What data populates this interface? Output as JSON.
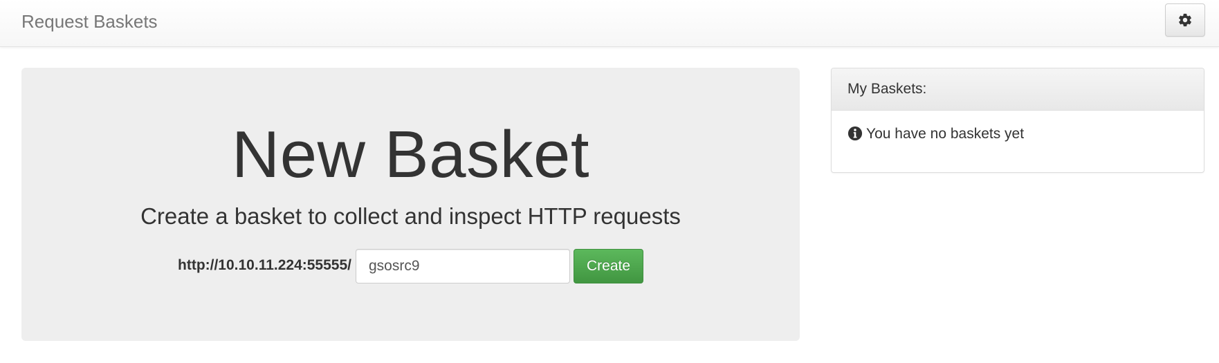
{
  "navbar": {
    "brand": "Request Baskets",
    "settings_icon": "gear-icon"
  },
  "new_basket": {
    "title": "New Basket",
    "subtitle": "Create a basket to collect and inspect HTTP requests",
    "url_prefix": "http://10.10.11.224:55555/",
    "basket_name_value": "gsosrc9",
    "create_label": "Create"
  },
  "my_baskets": {
    "title": "My Baskets:",
    "empty_icon": "info-circle-icon",
    "empty_message": "You have no baskets yet"
  },
  "colors": {
    "create_button": "#5cb85c",
    "jumbotron_bg": "#eeeeee",
    "brand_text": "#777777"
  }
}
